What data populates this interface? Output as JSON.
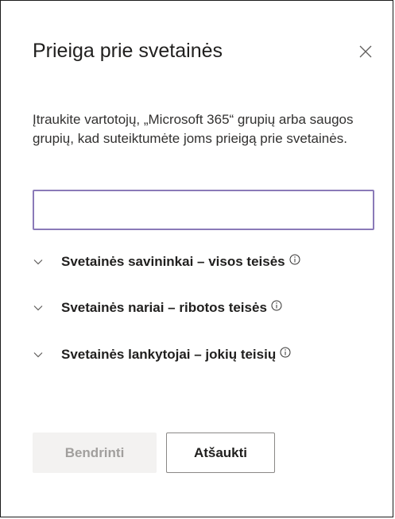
{
  "panel": {
    "title": "Prieiga prie svetainės",
    "close_icon": "close-icon",
    "description": "Įtraukite vartotojų, „Microsoft 365“ grupių arba saugos grupių, kad suteiktumėte joms prieigą prie svetainės.",
    "input": {
      "value": "",
      "border_color": "#8a7ab8"
    },
    "groups": [
      {
        "label": "Svetainės savininkai – visos teisės",
        "icon": "chevron-down-icon",
        "info_icon": "info-icon"
      },
      {
        "label": "Svetainės nariai – ribotos teisės",
        "icon": "chevron-down-icon",
        "info_icon": "info-icon"
      },
      {
        "label": "Svetainės lankytojai – jokių teisių",
        "icon": "chevron-down-icon",
        "info_icon": "info-icon"
      }
    ],
    "footer": {
      "share_label": "Bendrinti",
      "share_disabled": true,
      "cancel_label": "Atšaukti"
    }
  }
}
